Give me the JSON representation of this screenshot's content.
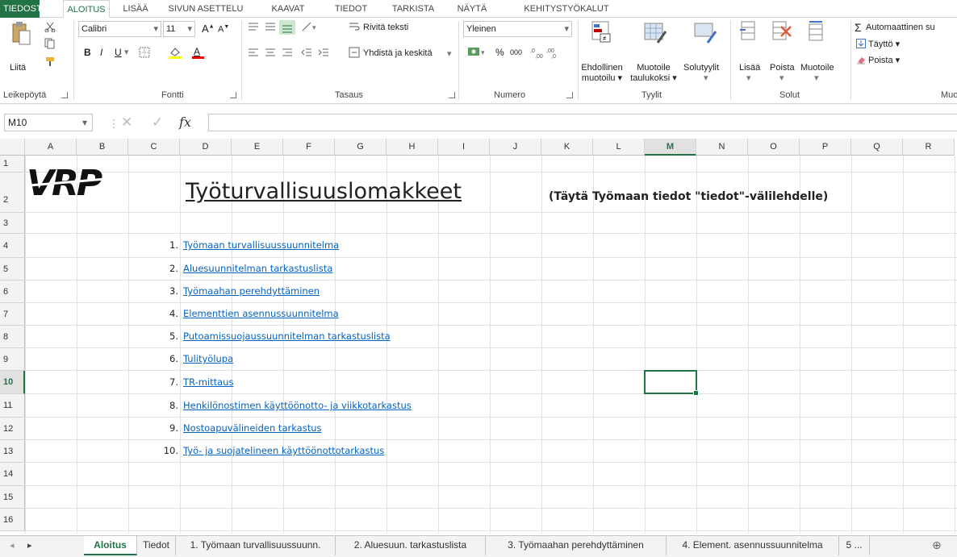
{
  "menu": {
    "file": "TIEDOSTO",
    "tabs": [
      "ALOITUS",
      "LISÄÄ",
      "SIVUN ASETTELU",
      "KAAVAT",
      "TIEDOT",
      "TARKISTA",
      "NÄYTÄ",
      "KEHITYSTYÖKALUT"
    ]
  },
  "ribbon": {
    "clipboard": {
      "paste": "Liitä",
      "label": "Leikepöytä"
    },
    "font": {
      "name": "Calibri",
      "size": "11",
      "label": "Fontti",
      "bold": "B",
      "italic": "I",
      "underline": "U"
    },
    "alignment": {
      "wrap": "Rivitä teksti",
      "merge": "Yhdistä ja keskitä",
      "label": "Tasaus"
    },
    "number": {
      "format": "Yleinen",
      "percent": "%",
      "thousands": "000",
      "label": "Numero"
    },
    "styles": {
      "cond1": "Ehdollinen",
      "cond2": "muotoilu ▾",
      "fmt1": "Muotoile",
      "fmt2": "taulukoksi ▾",
      "cell": "Solutyylit",
      "label": "Tyylit"
    },
    "cells": {
      "insert": "Lisää",
      "delete": "Poista",
      "format": "Muotoile",
      "label": "Solut"
    },
    "editing": {
      "autosum": "Automaattinen su",
      "fill": "Täyttö ▾",
      "clear": "Poista ▾",
      "label": "Muo"
    }
  },
  "formula": {
    "namebox": "M10",
    "fx": "fx",
    "value": ""
  },
  "columns": [
    "A",
    "B",
    "C",
    "D",
    "E",
    "F",
    "G",
    "H",
    "I",
    "J",
    "K",
    "L",
    "M",
    "N",
    "O",
    "P",
    "Q",
    "R"
  ],
  "selected_column": "M",
  "selected_row": "10",
  "rows": [
    "1",
    "2",
    "3",
    "4",
    "5",
    "6",
    "7",
    "8",
    "9",
    "10",
    "11",
    "12",
    "13",
    "14",
    "15",
    "16"
  ],
  "logo": "VRP",
  "title": "Työturvallisuuslomakkeet",
  "instruction": "(Täytä Työmaan tiedot \"tiedot\"-välilehdelle)",
  "links": [
    {
      "num": "1.",
      "text": "Työmaan turvallisuussuunnitelma"
    },
    {
      "num": "2.",
      "text": "Aluesuunnitelman tarkastuslista"
    },
    {
      "num": "3.",
      "text": "Työmaahan perehdyttäminen"
    },
    {
      "num": "4.",
      "text": "Elementtien asennussuunnitelma"
    },
    {
      "num": "5.",
      "text": "Putoamissuojaussuunnitelman tarkastuslista"
    },
    {
      "num": "6.",
      "text": "Tulityölupa"
    },
    {
      "num": "7.",
      "text": "TR-mittaus"
    },
    {
      "num": "8.",
      "text": "Henkilönostimen käyttöönotto- ja viikkotarkastus"
    },
    {
      "num": "9.",
      "text": "Nostoapuvälineiden tarkastus"
    },
    {
      "num": "10.",
      "text": "Työ- ja suojatelineen käyttöönottotarkastus"
    }
  ],
  "sheets": [
    "Aloitus",
    "Tiedot",
    "1. Työmaan turvallisuussuunn.",
    "2. Aluesuun. tarkastuslista",
    "3. Työmaahan perehdyttäminen",
    "4. Element. asennussuunnitelma",
    "5 ..."
  ],
  "active_sheet": "Aloitus",
  "colors": {
    "accent": "#217346",
    "link": "#0563c1"
  }
}
